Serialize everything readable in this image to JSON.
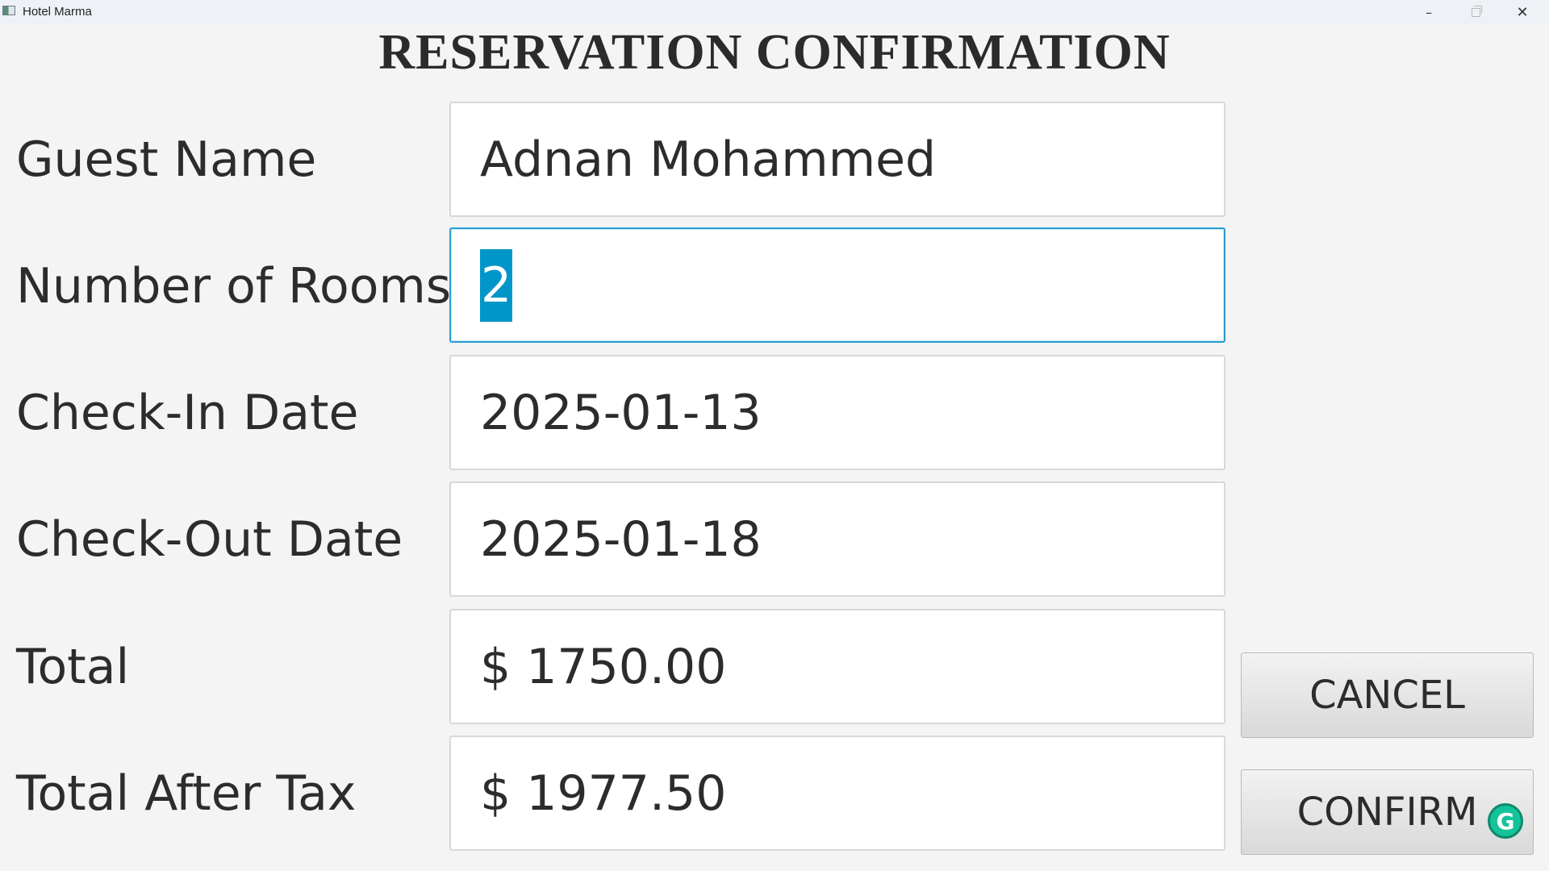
{
  "window": {
    "title": "Hotel Marma",
    "minimize_glyph": "–",
    "close_glyph": "✕"
  },
  "page": {
    "heading": "RESERVATION CONFIRMATION"
  },
  "form": {
    "guest_name": {
      "label": "Guest Name",
      "value": "Adnan Mohammed"
    },
    "rooms": {
      "label": "Number of Rooms",
      "value": "2"
    },
    "check_in": {
      "label": "Check-In Date",
      "value": "2025-01-13"
    },
    "check_out": {
      "label": "Check-Out Date",
      "value": "2025-01-18"
    },
    "total": {
      "label": "Total",
      "value": "$ 1750.00"
    },
    "total_after_tax": {
      "label": "Total After Tax",
      "value": "$ 1977.50"
    }
  },
  "actions": {
    "cancel_label": "CANCEL",
    "confirm_label": "CONFIRM"
  },
  "overlay": {
    "grammarly_glyph": "G",
    "grammarly_color": "#15c39a"
  },
  "colors": {
    "focus_border": "#2a9fd6",
    "selection": "#0096c9"
  }
}
